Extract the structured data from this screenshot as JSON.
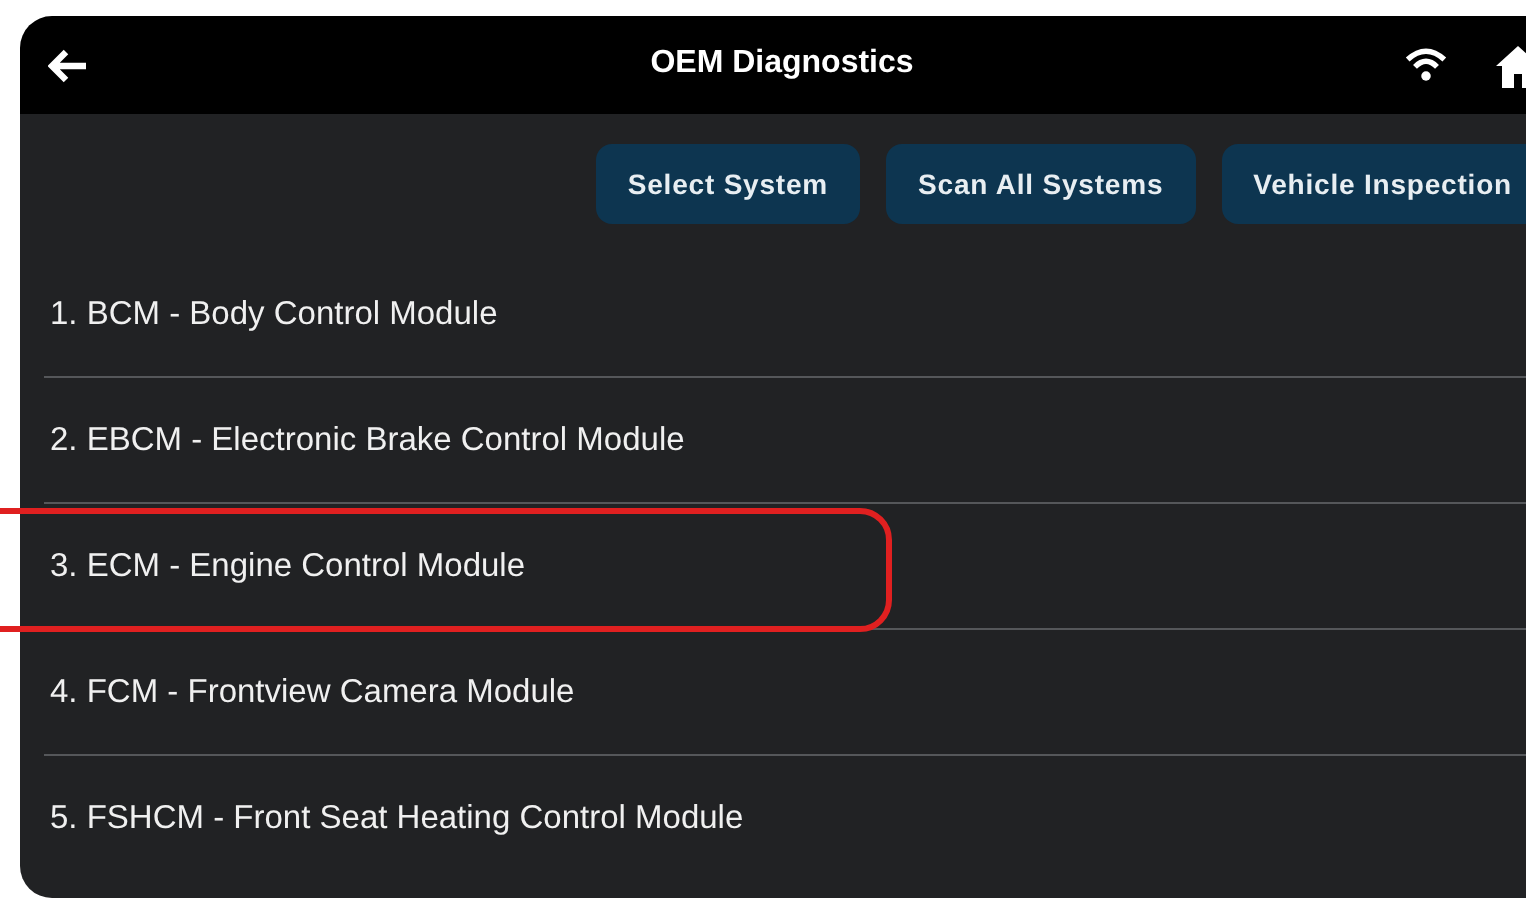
{
  "header": {
    "title": "OEM Diagnostics"
  },
  "buttons": [
    "Select System",
    "Scan All Systems",
    "Vehicle Inspection"
  ],
  "modules": [
    {
      "label": "1. BCM - Body Control Module",
      "highlighted": false
    },
    {
      "label": "2. EBCM - Electronic Brake Control Module",
      "highlighted": false
    },
    {
      "label": "3. ECM - Engine Control Module",
      "highlighted": true
    },
    {
      "label": "4. FCM - Frontview Camera Module",
      "highlighted": false
    },
    {
      "label": "5. FSHCM - Front Seat Heating Control Module",
      "highlighted": false
    }
  ]
}
